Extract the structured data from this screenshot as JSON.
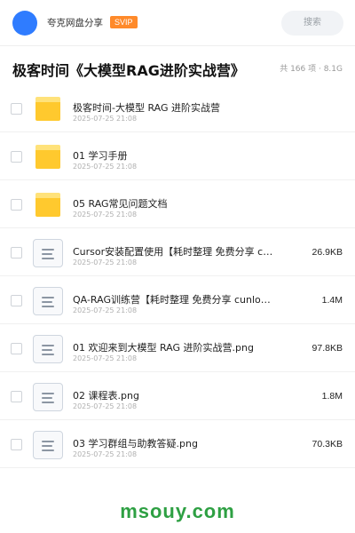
{
  "header": {
    "app_name": "夸克网盘分享",
    "badge": "SVIP",
    "search_label": "搜索",
    "avatar_color": "#2f7cff"
  },
  "title_bar": {
    "title": "极客时间《大模型RAG进阶实战营》",
    "summary": "共 166 项 · 8.1G"
  },
  "files": [
    {
      "type": "folder",
      "icon": "folder-icon",
      "name": "极客时间-大模型 RAG 进阶实战营",
      "date": "2025-07-25 21:08",
      "size": ""
    },
    {
      "type": "folder",
      "icon": "folder-icon",
      "name": "01 学习手册",
      "date": "2025-07-25 21:08",
      "size": ""
    },
    {
      "type": "folder",
      "icon": "folder-icon",
      "name": "05 RAG常见问题文档",
      "date": "2025-07-25 21:08",
      "size": ""
    },
    {
      "type": "file",
      "icon": "document-icon",
      "name": "Cursor安装配置使用【耗时整理 免费分享 cu…",
      "date": "2025-07-25 21:08",
      "size": "26.9KB"
    },
    {
      "type": "file",
      "icon": "document-icon",
      "name": "QA-RAG训练营【耗时整理 免费分享 cunlo…",
      "date": "2025-07-25 21:08",
      "size": "1.4M"
    },
    {
      "type": "file",
      "icon": "document-icon",
      "name": "01 欢迎来到大模型 RAG 进阶实战营.png",
      "date": "2025-07-25 21:08",
      "size": "97.8KB"
    },
    {
      "type": "file",
      "icon": "document-icon",
      "name": "02 课程表.png",
      "date": "2025-07-25 21:08",
      "size": "1.8M"
    },
    {
      "type": "file",
      "icon": "document-icon",
      "name": "03 学习群组与助教答疑.png",
      "date": "2025-07-25 21:08",
      "size": "70.3KB"
    }
  ],
  "watermark": "msouy.com",
  "colors": {
    "badge": "#ff8a2a",
    "folder": "#ffc92e",
    "watermark": "#2ea043"
  }
}
